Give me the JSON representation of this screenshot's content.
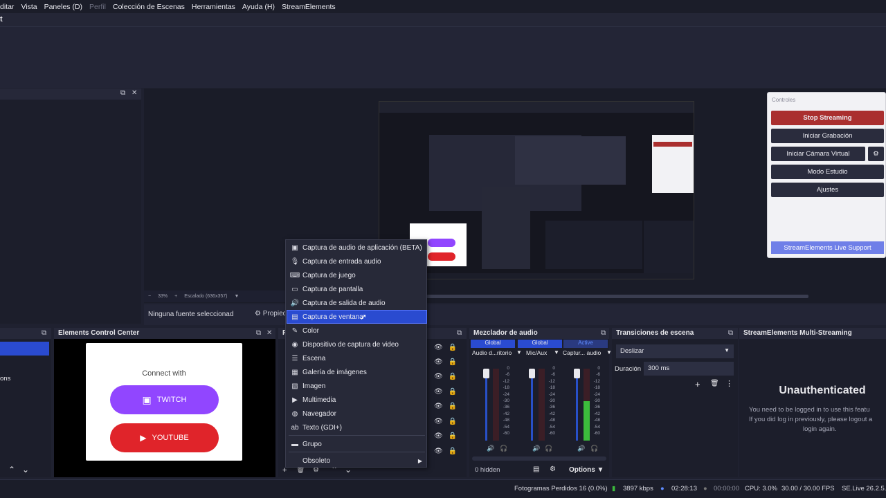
{
  "menu": [
    "ditar",
    "Vista",
    "Paneles (D)",
    "Perfil",
    "Colección de Escenas",
    "Herramientas",
    "Ayuda (H)",
    "StreamElements"
  ],
  "titlebar_letter": "t",
  "preview": {
    "zoom": "33%",
    "scale_label": "Escalado (636x357)",
    "no_source": "Ninguna fuente seleccionad",
    "properties": "Propied"
  },
  "elements_panel": {
    "title": "Elements Control Center",
    "connect_title": "Connect with",
    "twitch_label": "TWITCH",
    "youtube_label": "YOUTUBE",
    "left_fragment": "ons"
  },
  "sources_panel": {
    "title_fragment": "F"
  },
  "context_menu": {
    "items": [
      {
        "icon": "app-audio-icon",
        "glyph": "▣",
        "label": "Captura de audio de aplicación (BETA)"
      },
      {
        "icon": "microphone-icon",
        "glyph": "🎙",
        "label": "Captura de entrada audio"
      },
      {
        "icon": "gamepad-icon",
        "glyph": "⌨",
        "label": "Captura de juego"
      },
      {
        "icon": "monitor-icon",
        "glyph": "▭",
        "label": "Captura de pantalla"
      },
      {
        "icon": "speaker-icon",
        "glyph": "🔊",
        "label": "Captura de salida de audio"
      },
      {
        "icon": "window-icon",
        "glyph": "▤",
        "label": "Captura de ventana"
      },
      {
        "icon": "brush-icon",
        "glyph": "✎",
        "label": "Color"
      },
      {
        "icon": "camera-icon",
        "glyph": "◉",
        "label": "Dispositivo de captura de video"
      },
      {
        "icon": "scene-icon",
        "glyph": "☰",
        "label": "Escena"
      },
      {
        "icon": "images-icon",
        "glyph": "▦",
        "label": "Galería de imágenes"
      },
      {
        "icon": "image-icon",
        "glyph": "▧",
        "label": "Imagen"
      },
      {
        "icon": "play-icon",
        "glyph": "▶",
        "label": "Multimedia"
      },
      {
        "icon": "globe-icon",
        "glyph": "◍",
        "label": "Navegador"
      },
      {
        "icon": "text-icon",
        "glyph": "ab",
        "label": "Texto (GDI+)"
      },
      {
        "icon": "folder-icon",
        "glyph": "▬",
        "label": "Grupo"
      },
      {
        "icon": "",
        "glyph": "",
        "label": "Obsoleto"
      }
    ],
    "selected_index": 5
  },
  "mixer": {
    "title": "Mezclador de audio",
    "headers": [
      "Global",
      "Global",
      "Active"
    ],
    "channels": [
      "Audio d...ritorio",
      "Mic/Aux",
      "Captur... audio"
    ],
    "scale": [
      "0",
      "-6",
      "-12",
      "-18",
      "-24",
      "-30",
      "-36",
      "-42",
      "-48",
      "-54",
      "-60"
    ],
    "hidden": "0 hidden",
    "options": "Options",
    "levels": [
      0.0,
      0.0,
      0.55
    ]
  },
  "transitions": {
    "title": "Transiciones de escena",
    "type": "Deslizar",
    "duration_label": "Duración",
    "duration_value": "300 ms"
  },
  "multistream": {
    "title": "StreamElements Multi-Streaming",
    "heading": "Unauthenticated",
    "line1": "You need to be logged in to use this featu",
    "line2": "If you did log in previously, please logout a",
    "line3": "login again."
  },
  "controls": {
    "title": "Controles",
    "stop": "Stop Streaming",
    "record": "Iniciar Grabación",
    "virtualcam": "Iniciar Cámara Virtual",
    "studio": "Modo Estudio",
    "settings": "Ajustes",
    "support": "StreamElements Live Support"
  },
  "status": {
    "dropped": "Fotogramas Perdidos 16 (0.0%)",
    "kbps": "3897 kbps",
    "live_time": "02:28:13",
    "rec_time": "00:00:00",
    "cpu": "CPU: 3.0%",
    "fps": "30.00 / 30.00 FPS",
    "version": "SE.Live 26.2.5.5"
  },
  "colors": {
    "accent": "#2a4bd0",
    "stop": "#aa2f2f",
    "twitch": "#9146ff",
    "youtube": "#e0242a"
  }
}
